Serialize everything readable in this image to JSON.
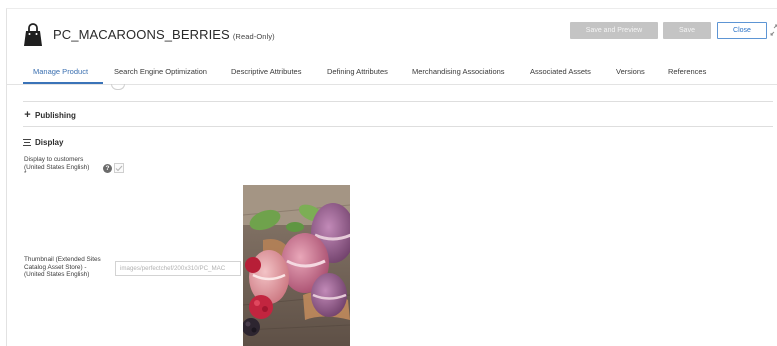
{
  "header": {
    "title": "PC_MACAROONS_BERRIES",
    "title_suffix": "(Read-Only)",
    "buttons": {
      "save_and_preview": "Save and Preview",
      "save": "Save",
      "close": "Close"
    }
  },
  "tabs": [
    {
      "label": "Manage Product",
      "active": true
    },
    {
      "label": "Search Engine Optimization",
      "active": false
    },
    {
      "label": "Descriptive Attributes",
      "active": false
    },
    {
      "label": "Defining Attributes",
      "active": false
    },
    {
      "label": "Merchandising Associations",
      "active": false
    },
    {
      "label": "Associated Assets",
      "active": false
    },
    {
      "label": "Versions",
      "active": false
    },
    {
      "label": "References",
      "active": false
    }
  ],
  "sections": {
    "publishing": {
      "label": "Publishing",
      "expanded": false
    },
    "display": {
      "label": "Display",
      "expanded": true
    }
  },
  "fields": {
    "display_to_customers": {
      "label_line1": "Display to customers",
      "label_line2": "(United States English)",
      "required_mark": "*",
      "checked": true
    },
    "thumbnail": {
      "label_line1": "Thumbnail (Extended Sites",
      "label_line2": "Catalog Asset Store) -",
      "label_line3": "(United States English)",
      "value": "images/perfectchef/200x310/PC_MAC"
    }
  },
  "colors": {
    "accent": "#3a73b8",
    "disabled_button": "#c4c4c4",
    "close_border": "#5d95d4"
  },
  "icons": {
    "product": "shopping-bag-icon",
    "expand": "expand-icon",
    "help": "help-icon",
    "checkbox": "checkmark-icon"
  }
}
